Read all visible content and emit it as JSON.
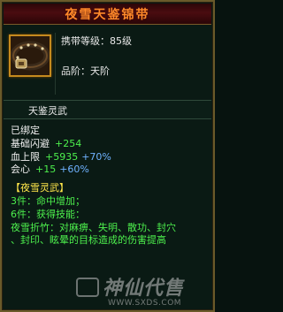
{
  "tooltip": {
    "title": "夜雪天鉴锦带",
    "carry_level": "携带等级：85级",
    "rank": "品阶：天阶",
    "series_name": "天鉴灵武",
    "bound_status": "已绑定",
    "stats": [
      {
        "label": "基础闪避",
        "value": "+254",
        "pct": ""
      },
      {
        "label": "血上限",
        "value": "+5935",
        "pct": "+70%"
      },
      {
        "label": "会心",
        "value": "+15",
        "pct": "+60%"
      }
    ],
    "set_name": "【夜雪灵武】",
    "set_bonus_3": "3件：命中增加；",
    "set_bonus_6": "6件：获得技能：",
    "skill_line_1": "夜雪折竹：对麻痹、失明、散功、封穴",
    "skill_line_2": "、封印、眩晕的目标造成的伤害提高"
  },
  "watermark": {
    "text": "神仙代售",
    "url": "WWW.SXDS.COM"
  },
  "colors": {
    "title": "#ff8a2a",
    "stat_green": "#4df04d",
    "stat_blue": "#6fb2ff",
    "set_yellow": "#ffe64a",
    "border_gold": "#c58a1e"
  },
  "icon": "belt-item-icon"
}
